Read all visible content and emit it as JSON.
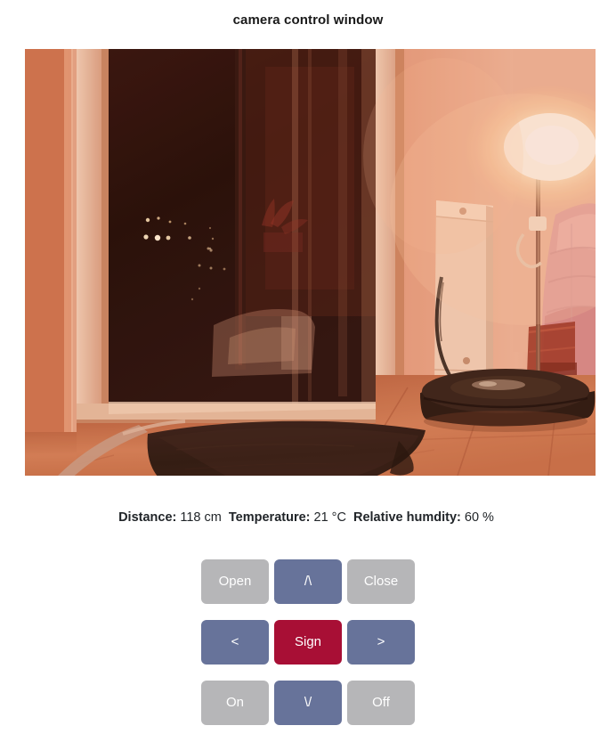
{
  "window": {
    "title": "camera control window"
  },
  "camera": {
    "name": "camera-feed",
    "alt": "live camera view of an apartment entrance at night",
    "scene": {
      "description": "Night-time indoor view toward a balcony door. A dark doormat lies on warm parquet flooring in front of a glazed door, a robot vacuum sits to the right, and a bright floor lamp glows near a pink quilted armchair.",
      "palette": {
        "wall_warm": "#d07a58",
        "wall_light": "#e8a184",
        "glass_dark": "#3a1510",
        "glass_darkest": "#1d0b08",
        "door_frame": "#e6b79b",
        "floor_wood": "#c9714c",
        "floor_wood_light": "#dd8f68",
        "mat_dark": "#2a1a15",
        "lamp_glow": "#fff6e2",
        "chair_pink": "#e09a9a",
        "vacuum_dark": "#2b1c18",
        "radiator_white": "#f0cdb6"
      }
    }
  },
  "sensors": [
    {
      "label": "Distance:",
      "value": "118 cm"
    },
    {
      "label": "Temperature:",
      "value": "21 °C"
    },
    {
      "label": "Relative humdity:",
      "value": "60 %"
    }
  ],
  "controls": {
    "colors": {
      "secondary": "#b6b6b8",
      "slate": "#67739a",
      "danger": "#a80f35"
    },
    "rows": [
      [
        {
          "name": "open-button",
          "label": "Open",
          "style": "btn-secondary"
        },
        {
          "name": "up-button",
          "label": "/\\",
          "style": "btn-slate"
        },
        {
          "name": "close-button",
          "label": "Close",
          "style": "btn-secondary"
        }
      ],
      [
        {
          "name": "left-button",
          "label": "<",
          "style": "btn-slate"
        },
        {
          "name": "sign-button",
          "label": "Sign",
          "style": "btn-danger"
        },
        {
          "name": "right-button",
          "label": ">",
          "style": "btn-slate"
        }
      ],
      [
        {
          "name": "on-button",
          "label": "On",
          "style": "btn-secondary"
        },
        {
          "name": "down-button",
          "label": "\\/",
          "style": "btn-slate"
        },
        {
          "name": "off-button",
          "label": "Off",
          "style": "btn-secondary"
        }
      ]
    ]
  }
}
